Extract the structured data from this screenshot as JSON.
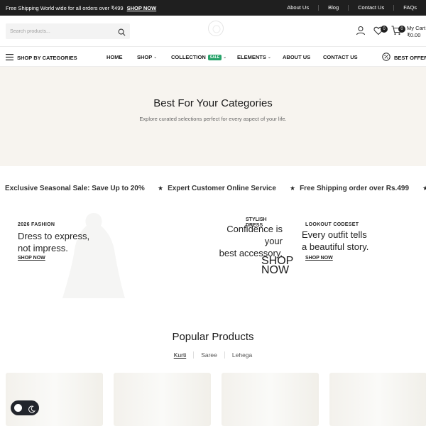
{
  "topbar": {
    "shipping_text": "Free Shipping World wide for all orders over ₹499",
    "shipping_link": "SHOP NOW",
    "links": [
      "About Us",
      "Blog",
      "Contact Us",
      "FAQs"
    ]
  },
  "header": {
    "search_placeholder": "Search products...",
    "wishlist_count": "0",
    "cart_count": "0",
    "cart_label": "My Cart",
    "cart_total": "₹0.00"
  },
  "nav": {
    "categories_label": "SHOP BY CATEGORIES",
    "items": [
      "HOME",
      "SHOP",
      "COLLECTION",
      "ELEMENTS",
      "ABOUT US",
      "CONTACT US"
    ],
    "sale_badge": "SALE",
    "offers_label": "BEST OFFERS"
  },
  "hero": {
    "title": "Best For Your Categories",
    "subtitle": "Explore curated selections perfect for every aspect of your life."
  },
  "marquee": {
    "items": [
      "Exclusive Seasonal Sale: Save Up to 20%",
      "Expert Customer Online Service",
      "Free Shipping order over Rs.499"
    ]
  },
  "promos": [
    {
      "kicker": "2026 FASHION",
      "heading_line1": "Dress to express,",
      "heading_line2": "not impress.",
      "link": "SHOP NOW"
    },
    {
      "kicker_line1": "STYLISH",
      "kicker_line2": "DRESS",
      "heading_line1": "Confidence is",
      "heading_line2": "your",
      "heading_line3": "best accessory.",
      "link_line1": "SHOP",
      "link_line2": "NOW"
    },
    {
      "kicker": "LOOKOUT CODESET",
      "heading_line1": "Every outfit tells",
      "heading_line2": "a beautiful story.",
      "link": "SHOP NOW"
    }
  ],
  "popular": {
    "title": "Popular Products",
    "tabs": [
      "Kurti",
      "Saree",
      "Lehega"
    ],
    "active_tab": "Kurti"
  },
  "colors": {
    "topbar_bg": "#1f1f1f",
    "hero_bg": "#f7f4ef",
    "sale_badge": "#27a36a",
    "toggle_bg": "#22252c"
  }
}
